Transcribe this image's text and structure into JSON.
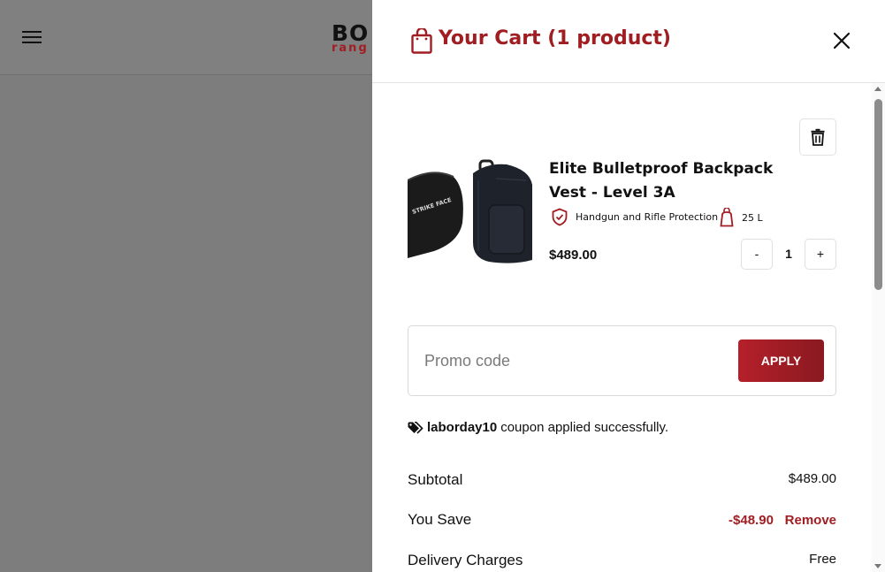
{
  "page": {
    "logo_text": "BO",
    "logo_sub": "rang"
  },
  "cart": {
    "title": "Your Cart (1 product)",
    "item": {
      "name": "Elite Bulletproof Backpack Vest - Level 3A",
      "feature_1": "Handgun and Rifle Protection",
      "feature_2": "25 L",
      "price": "$489.00",
      "quantity": "1",
      "qty_minus": "-",
      "qty_plus": "+",
      "image_label": "STRIKE FACE"
    },
    "promo": {
      "placeholder": "Promo code",
      "value": "",
      "apply_label": "APPLY"
    },
    "coupon": {
      "code": "laborday10",
      "message": "coupon applied successfully."
    },
    "summary": {
      "subtotal_label": "Subtotal",
      "subtotal_value": "$489.00",
      "save_label": "You Save",
      "save_value": "-$48.90",
      "remove_label": "Remove",
      "delivery_label": "Delivery Charges",
      "delivery_value": "Free"
    }
  },
  "colors": {
    "accent": "#a01e22",
    "overlay": "#808080"
  },
  "icons": {
    "menu": "hamburger-menu-icon",
    "cart": "shopping-bag-icon",
    "close": "close-icon",
    "trash": "trash-icon",
    "shield": "shield-check-icon",
    "bag": "backpack-icon",
    "tag": "tags-icon"
  }
}
